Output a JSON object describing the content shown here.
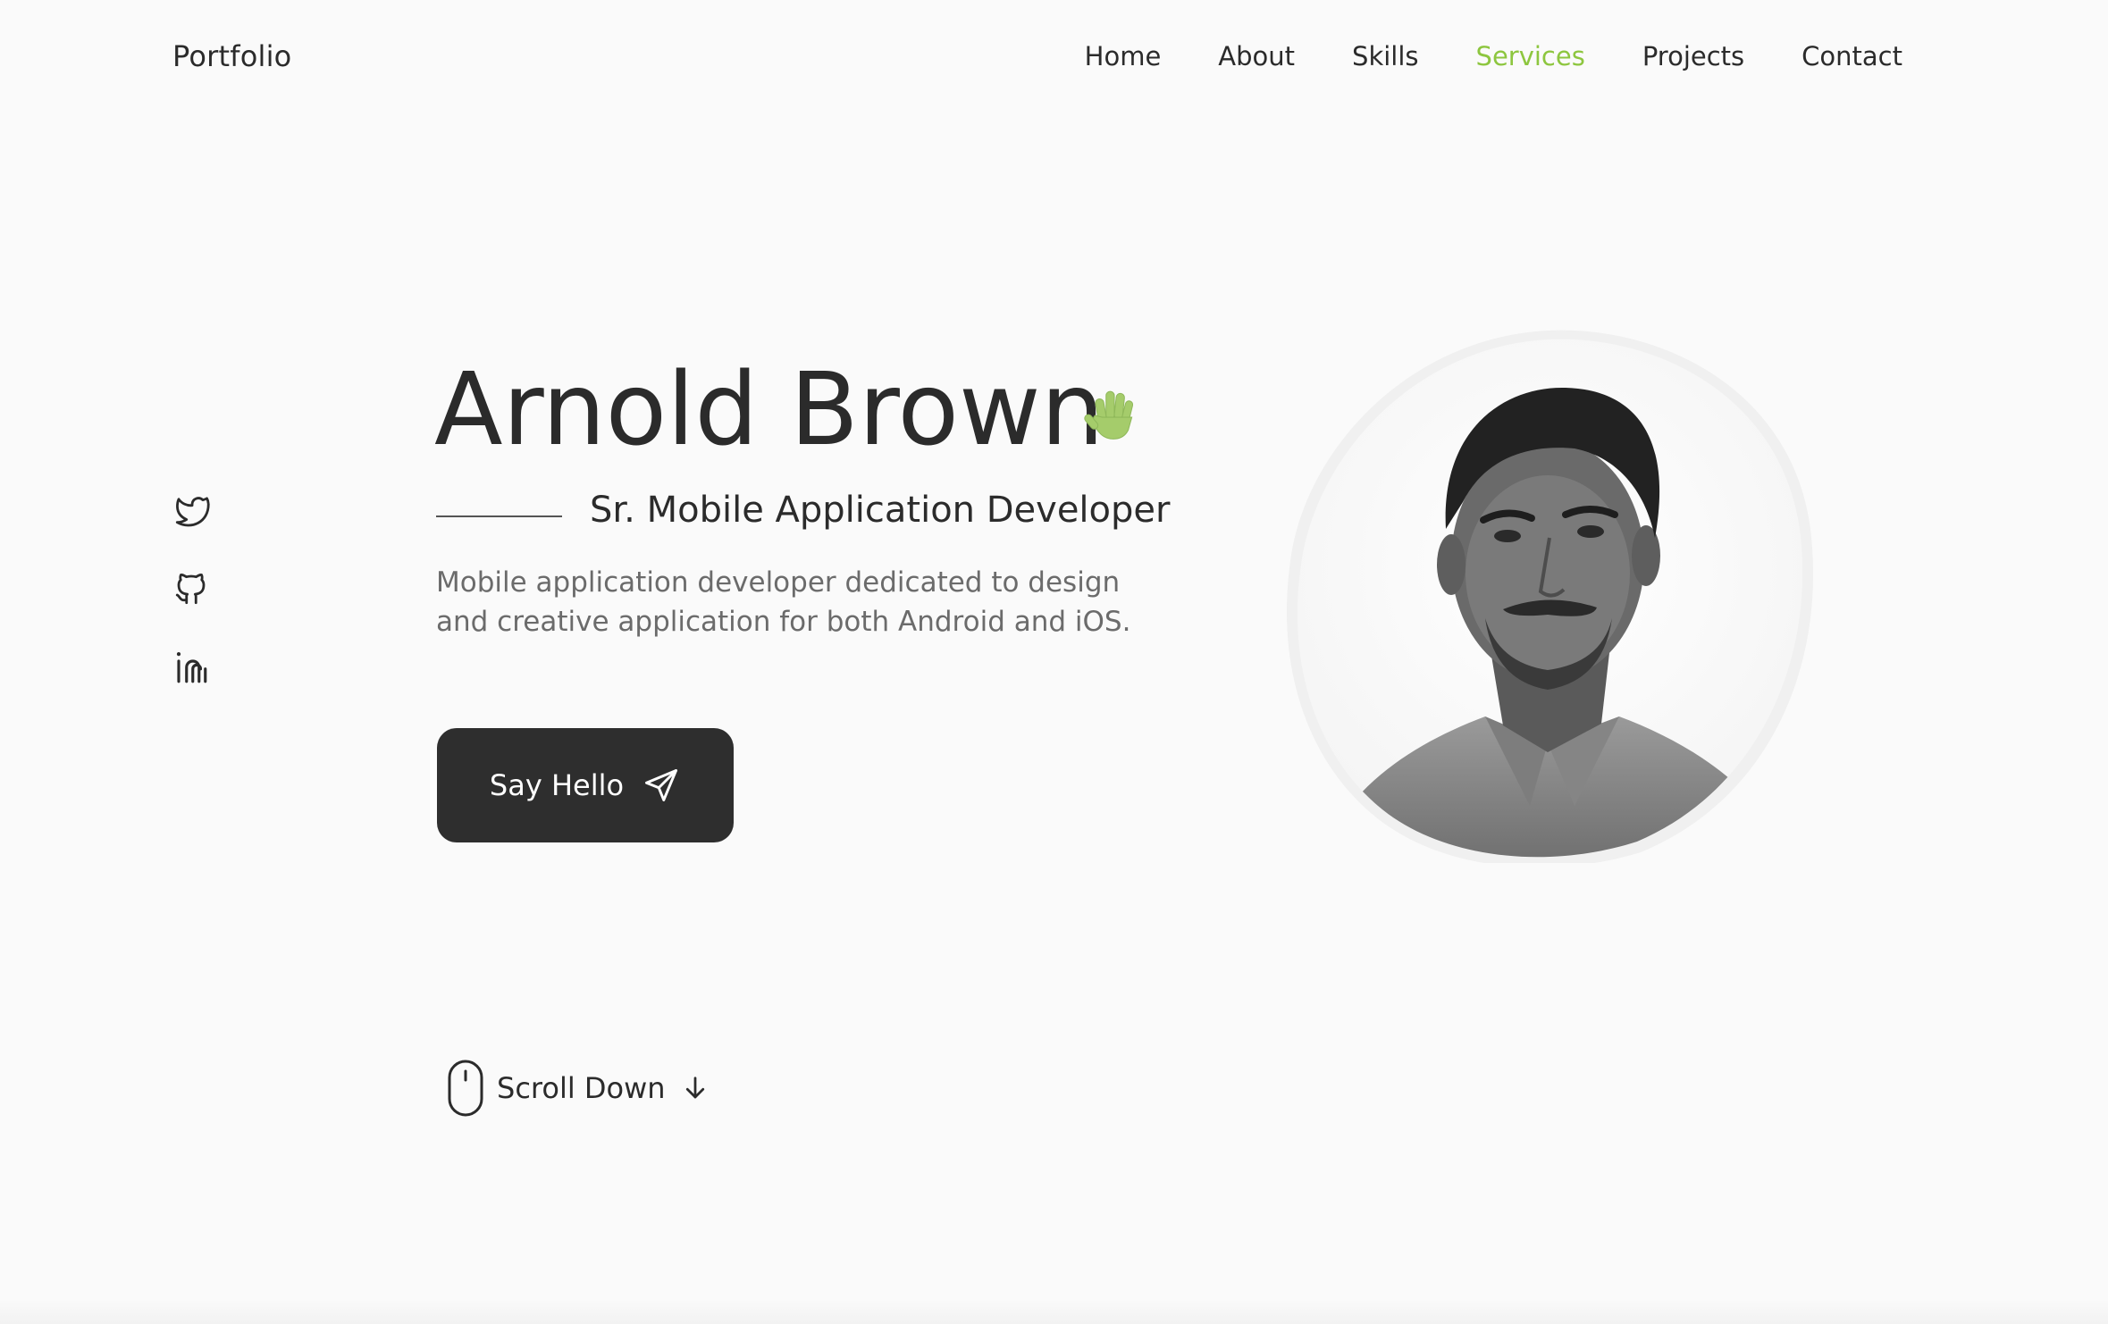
{
  "header": {
    "brand": "Portfolio",
    "nav": [
      {
        "label": "Home",
        "active": false
      },
      {
        "label": "About",
        "active": false
      },
      {
        "label": "Skills",
        "active": false
      },
      {
        "label": "Services",
        "active": true
      },
      {
        "label": "Projects",
        "active": false
      },
      {
        "label": "Contact",
        "active": false
      }
    ]
  },
  "social": [
    "twitter-icon",
    "github-icon",
    "linkedin-icon"
  ],
  "hero": {
    "name": "Arnold Brown",
    "subtitle": "Sr. Mobile Application Developer",
    "description": "Mobile application developer dedicated to design and creative application for both Android and iOS.",
    "cta_label": "Say Hello",
    "scroll_label": "Scroll Down"
  },
  "colors": {
    "accent": "#8dc63f",
    "dark": "#2e2e2e",
    "background": "#fafafa",
    "muted_text": "#6b6b6b"
  }
}
